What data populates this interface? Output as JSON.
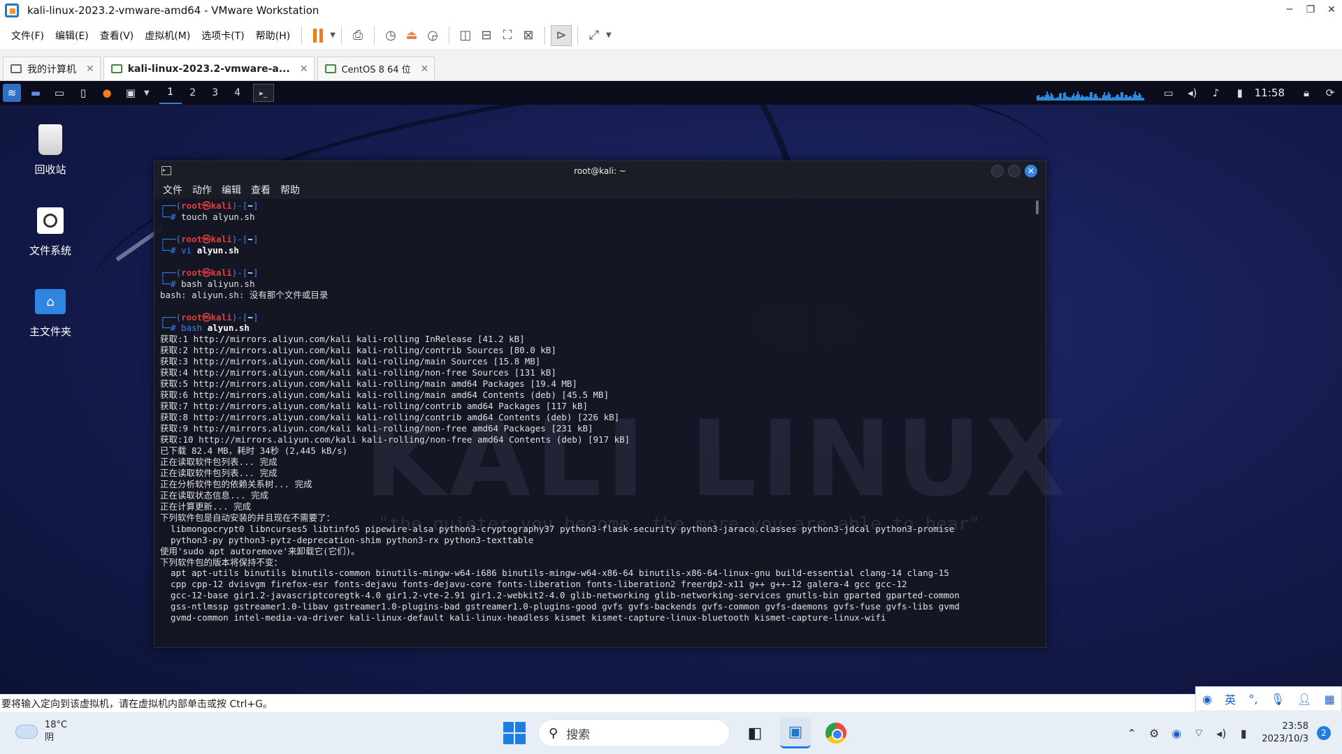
{
  "window": {
    "title": "kali-linux-2023.2-vmware-amd64 - VMware Workstation",
    "controls": [
      "─",
      "❐",
      "✕"
    ]
  },
  "menu": {
    "file": "文件(F)",
    "edit": "编辑(E)",
    "view": "查看(V)",
    "vm": "虚拟机(M)",
    "tabs": "选项卡(T)",
    "help": "帮助(H)"
  },
  "tabs": [
    {
      "label": "我的计算机"
    },
    {
      "label": "kali-linux-2023.2-vmware-a..."
    },
    {
      "label": "CentOS 8 64 位"
    }
  ],
  "guest_panel": {
    "workspaces": [
      "1",
      "2",
      "3",
      "4"
    ],
    "clock": "11:58"
  },
  "desktop": {
    "trash": "回收站",
    "filesystem": "文件系统",
    "home": "主文件夹"
  },
  "terminal": {
    "title": "root@kali: ~",
    "menu": [
      "文件",
      "动作",
      "编辑",
      "查看",
      "帮助"
    ],
    "prompt": {
      "open": "┌──(",
      "user": "root",
      "at": "㉿",
      "host": "kali",
      "close": ")-[",
      "dir": "~",
      "end": "]",
      "hash": "└─#"
    },
    "commands": {
      "c1": "touch alyun.sh",
      "c2_cmd": "vi",
      "c2_arg": "alyun.sh",
      "c3": "bash aliyun.sh",
      "c3_out": "bash: aliyun.sh: 没有那个文件或目录",
      "c4_cmd": "bash",
      "c4_arg": "alyun.sh"
    },
    "output_lines": [
      "获取:1 http://mirrors.aliyun.com/kali kali-rolling InRelease [41.2 kB]",
      "获取:2 http://mirrors.aliyun.com/kali kali-rolling/contrib Sources [80.0 kB]",
      "获取:3 http://mirrors.aliyun.com/kali kali-rolling/main Sources [15.8 MB]",
      "获取:4 http://mirrors.aliyun.com/kali kali-rolling/non-free Sources [131 kB]",
      "获取:5 http://mirrors.aliyun.com/kali kali-rolling/main amd64 Packages [19.4 MB]",
      "获取:6 http://mirrors.aliyun.com/kali kali-rolling/main amd64 Contents (deb) [45.5 MB]",
      "获取:7 http://mirrors.aliyun.com/kali kali-rolling/contrib amd64 Packages [117 kB]",
      "获取:8 http://mirrors.aliyun.com/kali kali-rolling/contrib amd64 Contents (deb) [226 kB]",
      "获取:9 http://mirrors.aliyun.com/kali kali-rolling/non-free amd64 Packages [231 kB]",
      "获取:10 http://mirrors.aliyun.com/kali kali-rolling/non-free amd64 Contents (deb) [917 kB]",
      "已下载 82.4 MB，耗时 34秒 (2,445 kB/s)",
      "正在读取软件包列表... 完成",
      "正在读取软件包列表... 完成",
      "正在分析软件包的依赖关系树... 完成",
      "正在读取状态信息... 完成",
      "正在计算更新... 完成",
      "下列软件包是自动安装的并且现在不需要了：",
      "  libmongocrypt0 libncurses5 libtinfo5 pipewire-alsa python3-cryptography37 python3-flask-security python3-jaraco.classes python3-jdcal python3-promise",
      "  python3-py python3-pytz-deprecation-shim python3-rx python3-texttable",
      "使用'sudo apt autoremove'来卸载它(它们)。",
      "下列软件包的版本将保持不变：",
      "  apt apt-utils binutils binutils-common binutils-mingw-w64-i686 binutils-mingw-w64-x86-64 binutils-x86-64-linux-gnu build-essential clang-14 clang-15",
      "  cpp cpp-12 dvisvgm firefox-esr fonts-dejavu fonts-dejavu-core fonts-liberation fonts-liberation2 freerdp2-x11 g++ g++-12 galera-4 gcc gcc-12",
      "  gcc-12-base gir1.2-javascriptcoregtk-4.0 gir1.2-vte-2.91 gir1.2-webkit2-4.0 glib-networking glib-networking-services gnutls-bin gparted gparted-common",
      "  gss-ntlmssp gstreamer1.0-libav gstreamer1.0-plugins-bad gstreamer1.0-plugins-good gvfs gvfs-backends gvfs-common gvfs-daemons gvfs-fuse gvfs-libs gvmd",
      "  gvmd-common intel-media-va-driver kali-linux-default kali-linux-headless kismet kismet-capture-linux-bluetooth kismet-capture-linux-wifi"
    ],
    "watermark": "KALI LINUX",
    "quote": "\"the quieter you become, the more you are able to hear\""
  },
  "statusbar": {
    "message": "要将输入定向到该虚拟机，请在虚拟机内部单击或按 Ctrl+G。",
    "ime": [
      "英"
    ]
  },
  "taskbar": {
    "weather_temp": "18°C",
    "weather_desc": "阴",
    "search_placeholder": "搜索",
    "time": "23:58",
    "date": "2023/10/3",
    "notifications": "2"
  }
}
